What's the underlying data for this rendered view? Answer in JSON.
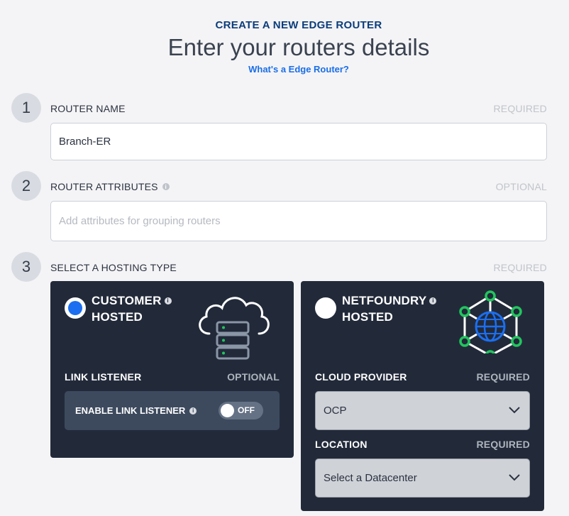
{
  "header": {
    "eyebrow": "CREATE A NEW EDGE ROUTER",
    "title": "Enter your routers details",
    "help_link": "What's a Edge Router?"
  },
  "steps": [
    {
      "number": "1",
      "label": "ROUTER NAME",
      "requirement": "REQUIRED",
      "value": "Branch-ER",
      "placeholder": ""
    },
    {
      "number": "2",
      "label": "ROUTER ATTRIBUTES",
      "requirement": "OPTIONAL",
      "value": "",
      "placeholder": "Add attributes for grouping routers"
    },
    {
      "number": "3",
      "label": "SELECT A HOSTING TYPE",
      "requirement": "REQUIRED"
    }
  ],
  "hosting": {
    "customer": {
      "title_line1": "CUSTOMER",
      "title_line2": "HOSTED",
      "selected": true,
      "icon": "cloud-server-icon",
      "link_listener_label": "LINK LISTENER",
      "link_listener_requirement": "OPTIONAL",
      "enable_label": "ENABLE LINK LISTENER",
      "toggle_state": "OFF"
    },
    "netfoundry": {
      "title_line1": "NETFOUNDRY",
      "title_line2": "HOSTED",
      "selected": false,
      "icon": "global-network-icon",
      "cloud_provider_label": "CLOUD PROVIDER",
      "cloud_provider_requirement": "REQUIRED",
      "cloud_provider_value": "OCP",
      "location_label": "LOCATION",
      "location_requirement": "REQUIRED",
      "location_value": "Select a Datacenter"
    }
  },
  "colors": {
    "accent": "#1b6ff0",
    "card_bg": "#222a3a",
    "network_green": "#22c55e",
    "header_blue": "#0b3d7a"
  }
}
